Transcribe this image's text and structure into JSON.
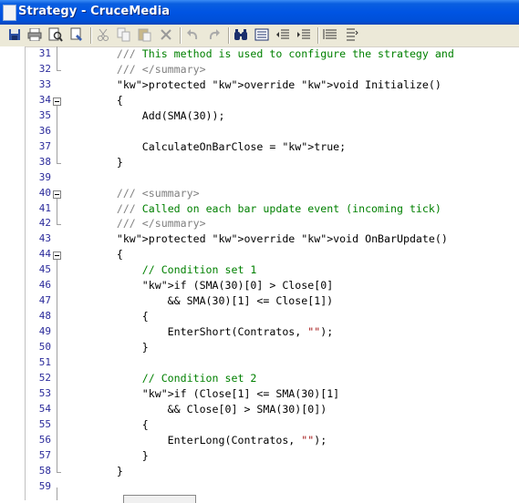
{
  "window": {
    "title": "Strategy - CruceMedia"
  },
  "toolbar": {
    "buttons": [
      {
        "name": "save-icon"
      },
      {
        "name": "print-icon"
      },
      {
        "name": "print-preview-icon"
      },
      {
        "name": "properties-icon"
      },
      {
        "name": "cut-icon"
      },
      {
        "name": "copy-icon"
      },
      {
        "name": "paste-icon"
      },
      {
        "name": "delete-icon"
      },
      {
        "name": "undo-icon"
      },
      {
        "name": "redo-icon"
      },
      {
        "name": "find-icon"
      },
      {
        "name": "replace-icon"
      },
      {
        "name": "outdent-icon"
      },
      {
        "name": "indent-icon"
      },
      {
        "name": "comment-icon"
      },
      {
        "name": "uncomment-icon"
      }
    ]
  },
  "editor": {
    "lines": [
      {
        "n": "31",
        "t": "        /// This method is used to configure the strategy and"
      },
      {
        "n": "32",
        "t": "        /// </summary>"
      },
      {
        "n": "33",
        "t": "        protected override void Initialize()"
      },
      {
        "n": "34",
        "t": "        {"
      },
      {
        "n": "35",
        "t": "            Add(SMA(30));"
      },
      {
        "n": "36",
        "t": ""
      },
      {
        "n": "37",
        "t": "            CalculateOnBarClose = true;"
      },
      {
        "n": "38",
        "t": "        }"
      },
      {
        "n": "39",
        "t": ""
      },
      {
        "n": "40",
        "t": "        /// <summary>"
      },
      {
        "n": "41",
        "t": "        /// Called on each bar update event (incoming tick)"
      },
      {
        "n": "42",
        "t": "        /// </summary>"
      },
      {
        "n": "43",
        "t": "        protected override void OnBarUpdate()"
      },
      {
        "n": "44",
        "t": "        {"
      },
      {
        "n": "45",
        "t": "            // Condition set 1"
      },
      {
        "n": "46",
        "t": "            if (SMA(30)[0] > Close[0]"
      },
      {
        "n": "47",
        "t": "                && SMA(30)[1] <= Close[1])"
      },
      {
        "n": "48",
        "t": "            {"
      },
      {
        "n": "49",
        "t": "                EnterShort(Contratos, \"\");"
      },
      {
        "n": "50",
        "t": "            }"
      },
      {
        "n": "51",
        "t": ""
      },
      {
        "n": "52",
        "t": "            // Condition set 2"
      },
      {
        "n": "53",
        "t": "            if (Close[1] <= SMA(30)[1]"
      },
      {
        "n": "54",
        "t": "                && Close[0] > SMA(30)[0])"
      },
      {
        "n": "55",
        "t": "            {"
      },
      {
        "n": "56",
        "t": "                EnterLong(Contratos, \"\");"
      },
      {
        "n": "57",
        "t": "            }"
      },
      {
        "n": "58",
        "t": "        }"
      },
      {
        "n": "59",
        "t": ""
      }
    ]
  }
}
